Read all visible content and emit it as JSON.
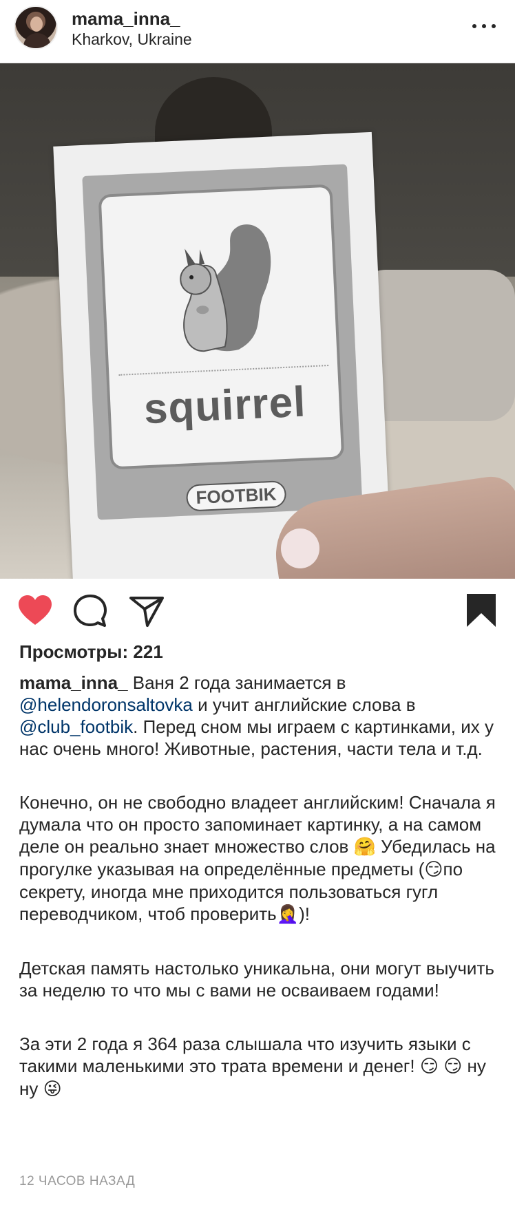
{
  "header": {
    "username": "mama_inna_",
    "location": "Kharkov, Ukraine"
  },
  "photo": {
    "card_word": "squirrel",
    "card_logo": "FOOTBIK"
  },
  "actions": {
    "liked": true,
    "like_color": "#ed4956",
    "icons": [
      "heart-icon",
      "comment-icon",
      "share-icon",
      "bookmark-icon"
    ]
  },
  "views": "Просмотры: 221",
  "caption": {
    "username": "mama_inna_",
    "p1_a": " Ваня 2 года занимается в ",
    "mention1": "@helendoronsaltovka",
    "p1_b": " и учит английские слова в ",
    "mention2": "@club_footbik",
    "p1_c": ". Перед сном мы играем с картинками, их у нас очень много! Животные, растения, части тела и т.д.",
    "p2_a": "Конечно, он не свободно владеет английским! Сначала я думала что он просто запоминает картинку, а на самом деле он реально знает множество слов ",
    "p2_emoji1": "🤗",
    "p2_b": " Убедилась на прогулке указывая на определённые предметы (",
    "p2_emoji2": "😏",
    "p2_c": "по секрету, иногда мне приходится пользоваться гугл переводчиком, чтоб проверить",
    "p2_emoji3": "🤦‍♀️",
    "p2_d": ")!",
    "p3": "Детская память настолько уникальна, они могут выучить за неделю то что мы с вами не осваиваем годами!",
    "p4_a": "За эти 2 года я 364 раза слышала что изучить языки с такими маленькими это трата времени и денег! ",
    "p4_emoji1": "😏",
    "p4_emoji2": "😏",
    "p4_b": " ну ну ",
    "p4_emoji3": "😜"
  },
  "timestamp": "12 ЧАСОВ НАЗАД"
}
